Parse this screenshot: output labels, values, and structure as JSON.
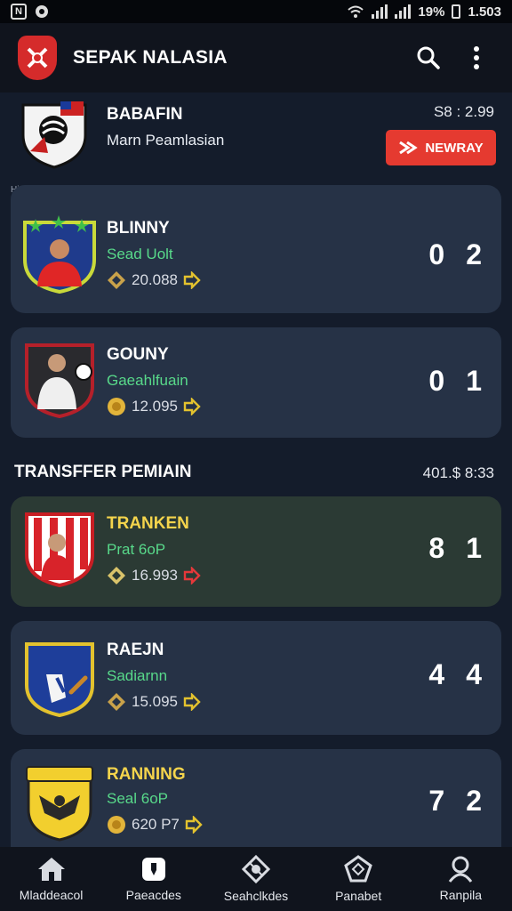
{
  "status_bar": {
    "battery_pct": "19%",
    "time": "1.503"
  },
  "app": {
    "title": "SEPAK NALASIA"
  },
  "featured": {
    "name": "BABAFIN",
    "subtitle": "Marn Peamlasian",
    "time": "S8 : 2.99",
    "button": "NEWRAY"
  },
  "section_small": "Hincnon",
  "cards_top": [
    {
      "name": "BLINNY",
      "sub": "Sead Uolt",
      "stat": "20.088",
      "score": [
        "0",
        "2"
      ]
    },
    {
      "name": "GOUNY",
      "sub": "Gaeahlfuain",
      "stat": "12.095",
      "score": [
        "0",
        "1"
      ]
    }
  ],
  "transfer": {
    "title": "TRANSFFER PEMIAIN",
    "right": "401.$ 8:33"
  },
  "cards_bottom": [
    {
      "name": "TRANKEN",
      "sub": "Prat 6oP",
      "stat": "16.993",
      "score": [
        "8",
        "1"
      ]
    },
    {
      "name": "RAEJN",
      "sub": "Sadiarnn",
      "stat": "15.095",
      "score": [
        "4",
        "4"
      ]
    },
    {
      "name": "RANNING",
      "sub": "Seal 6oP",
      "stat": "620 P7",
      "score": [
        "7",
        "2"
      ]
    }
  ],
  "nav": [
    "Mladdeacol",
    "Paeacdes",
    "Seahclkdes",
    "Panabet",
    "Ranpila"
  ]
}
